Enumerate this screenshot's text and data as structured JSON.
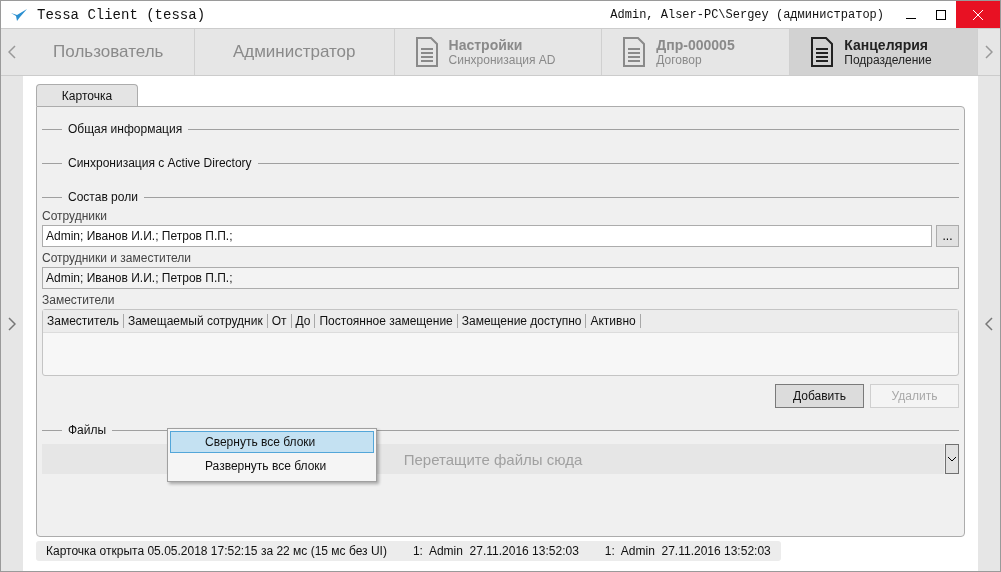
{
  "window": {
    "title": "Tessa Client (tessa)",
    "user": "Admin, Alser-PC\\Sergey (администратор)"
  },
  "tabs": [
    {
      "kind": "plain",
      "title": "Пользователь",
      "selected": false
    },
    {
      "kind": "plain",
      "title": "Администратор",
      "selected": false
    },
    {
      "kind": "doc",
      "title": "Настройки",
      "subtitle": "Синхронизация AD",
      "selected": false
    },
    {
      "kind": "doc",
      "title": "Дпр-000005",
      "subtitle": "Договор",
      "selected": false
    },
    {
      "kind": "doc",
      "title": "Канцелярия",
      "subtitle": "Подразделение",
      "selected": true
    }
  ],
  "card_tab": {
    "label": "Карточка"
  },
  "sections": [
    {
      "title": "Общая информация"
    },
    {
      "title": "Синхронизация с Active Directory"
    },
    {
      "title": "Состав роли"
    }
  ],
  "fields": [
    {
      "label": "Сотрудники",
      "value": "Admin; Иванов И.И.; Петров П.П.;",
      "button": "...",
      "disabled": false
    },
    {
      "label": "Сотрудники и заместители",
      "value": "Admin; Иванов И.И.; Петров П.П.;",
      "disabled": true
    }
  ],
  "substitutes": {
    "label": "Заместители",
    "columns": [
      "Заместитель",
      "Замещаемый сотрудник",
      "От",
      "До",
      "Постоянное замещение",
      "Замещение доступно",
      "Активно"
    ]
  },
  "buttons": [
    {
      "label": "Добавить",
      "disabled": false
    },
    {
      "label": "Удалить",
      "disabled": true
    }
  ],
  "files": {
    "title": "Файлы",
    "drop_hint": "Перетащите файлы сюда"
  },
  "context_menu": [
    {
      "label": "Свернуть все блоки",
      "selected": true
    },
    {
      "label": "Развернуть все блоки",
      "selected": false
    }
  ],
  "status_bar": [
    "Карточка открыта 05.05.2018 17:52:15 за 22 мс (15 мс без UI)",
    "1:  Admin  27.11.2016 13:52:03",
    "1:  Admin  27.11.2016 13:52:03"
  ]
}
